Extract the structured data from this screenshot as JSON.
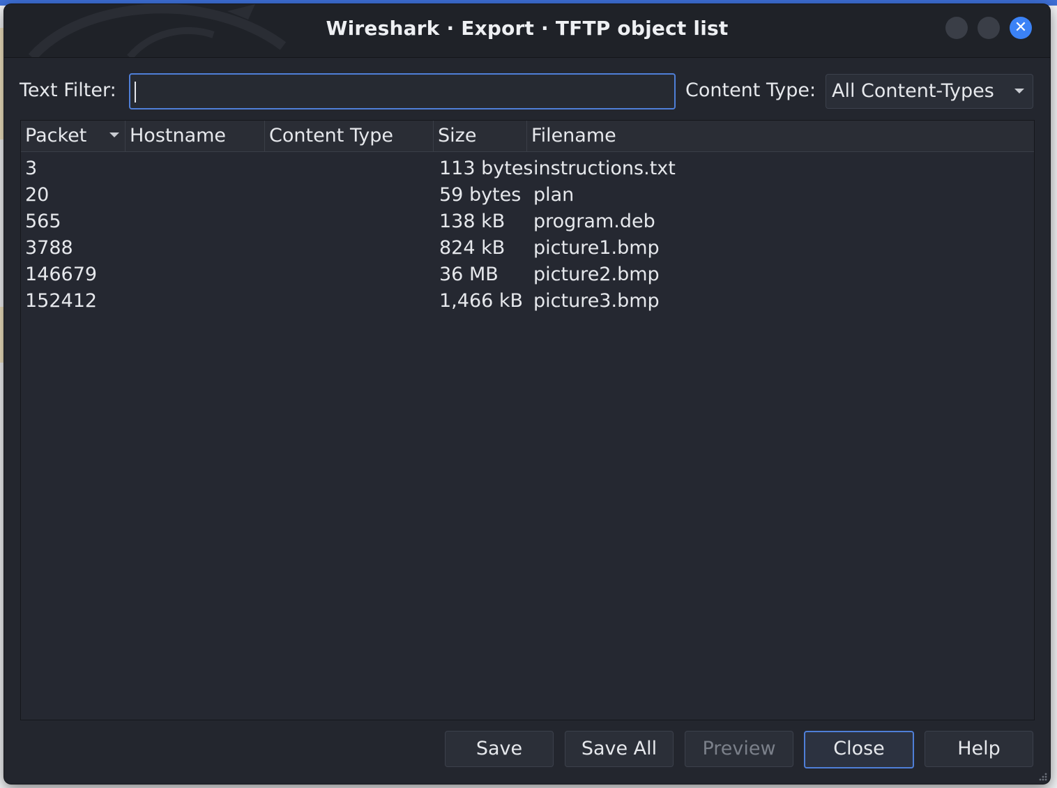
{
  "window": {
    "title": "Wireshark · Export · TFTP object list"
  },
  "filter": {
    "label": "Text Filter:",
    "value": ""
  },
  "content_type": {
    "label": "Content Type:",
    "selected": "All Content-Types"
  },
  "table": {
    "columns": [
      "Packet",
      "Hostname",
      "Content Type",
      "Size",
      "Filename"
    ],
    "rows": [
      {
        "packet": "3",
        "hostname": "",
        "content_type": "",
        "size": "113 bytes",
        "filename": "instructions.txt"
      },
      {
        "packet": "20",
        "hostname": "",
        "content_type": "",
        "size": "59 bytes",
        "filename": "plan"
      },
      {
        "packet": "565",
        "hostname": "",
        "content_type": "",
        "size": "138 kB",
        "filename": "program.deb"
      },
      {
        "packet": "3788",
        "hostname": "",
        "content_type": "",
        "size": "824 kB",
        "filename": "picture1.bmp"
      },
      {
        "packet": "146679",
        "hostname": "",
        "content_type": "",
        "size": "36 MB",
        "filename": "picture2.bmp"
      },
      {
        "packet": "152412",
        "hostname": "",
        "content_type": "",
        "size": "1,466 kB",
        "filename": "picture3.bmp"
      }
    ]
  },
  "buttons": {
    "save": "Save",
    "save_all": "Save All",
    "preview": "Preview",
    "close": "Close",
    "help": "Help"
  },
  "icons": {
    "close": "close-icon",
    "sort": "sort-desc-icon",
    "dropdown": "chevron-down-icon"
  },
  "colors": {
    "accent": "#3b82f6",
    "window_bg": "#23262e",
    "focus_border": "#4f7fd8"
  }
}
